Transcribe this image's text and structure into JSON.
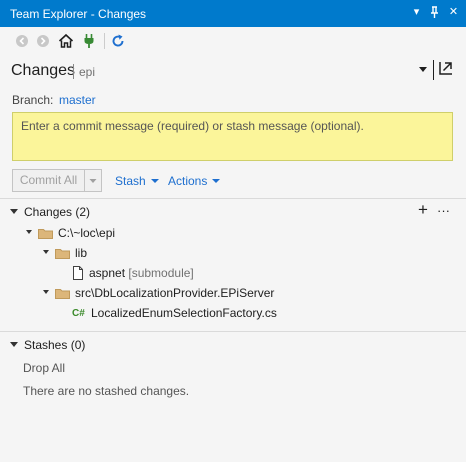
{
  "window": {
    "title": "Team Explorer - Changes",
    "title_buttons": {
      "dropdown": "▾",
      "pin": "⊥",
      "close": "✕"
    }
  },
  "toolbar": {
    "icons": [
      "back-arrow-icon",
      "forward-arrow-icon",
      "home-icon",
      "connect-plug-icon",
      "refresh-icon"
    ],
    "colors": {
      "home": "#1e1e1e",
      "plug": "#388a34",
      "refresh": "#1e6fcf"
    }
  },
  "header": {
    "title": "Changes",
    "subtitle": "epi"
  },
  "branch": {
    "label": "Branch:",
    "value": "master"
  },
  "commit": {
    "placeholder": "Enter a commit message (required) or stash message (optional).",
    "commit_all_label": "Commit All",
    "stash_label": "Stash",
    "actions_label": "Actions"
  },
  "changes": {
    "header": "Changes (2)",
    "tree": [
      {
        "label": "C:\\~loc\\epi",
        "type": "folder",
        "suffix": ""
      },
      {
        "label": "lib",
        "type": "folder",
        "suffix": ""
      },
      {
        "label": "aspnet",
        "type": "file",
        "suffix": "[submodule]"
      },
      {
        "label": "src\\DbLocalizationProvider.EPiServer",
        "type": "folder",
        "suffix": ""
      },
      {
        "label": "LocalizedEnumSelectionFactory.cs",
        "type": "csharp",
        "suffix": ""
      }
    ]
  },
  "stashes": {
    "header": "Stashes (0)",
    "drop_all": "Drop All",
    "empty_message": "There are no stashed changes."
  },
  "colors": {
    "accent": "#007acc",
    "link": "#1e6fcf",
    "commit_box_bg": "#fbf59a",
    "folder": "#dcb67a"
  }
}
